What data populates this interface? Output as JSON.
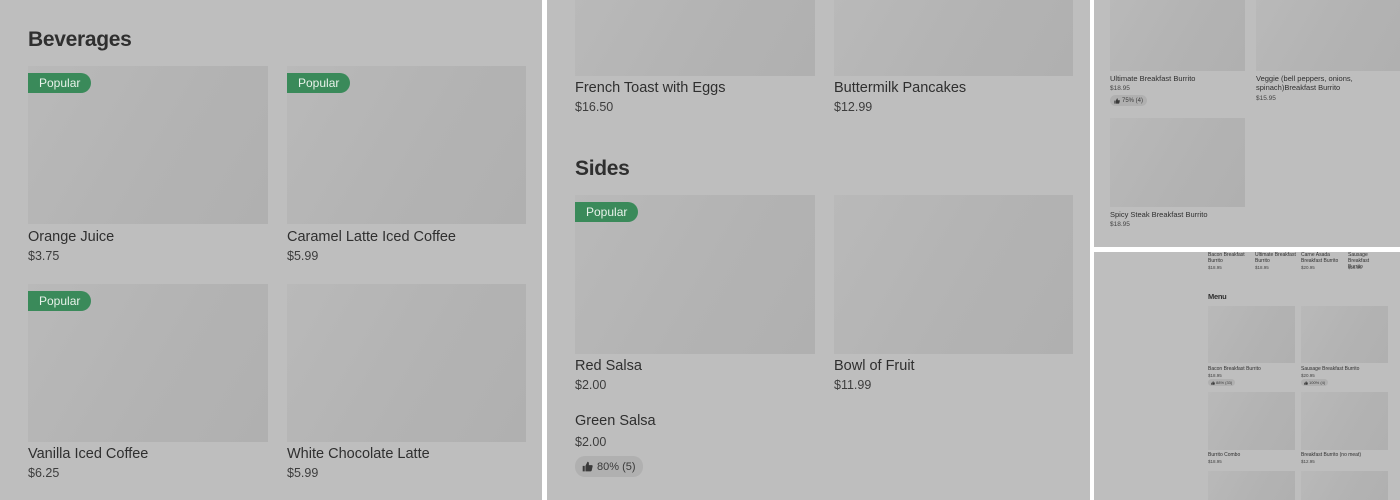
{
  "beverages": {
    "title": "Beverages",
    "items": [
      {
        "name": "Orange Juice",
        "price": "$3.75",
        "badge": "Popular"
      },
      {
        "name": "Caramel Latte Iced Coffee",
        "price": "$5.99",
        "badge": "Popular"
      },
      {
        "name": "Vanilla Iced Coffee",
        "price": "$6.25",
        "badge": "Popular"
      },
      {
        "name": "White Chocolate Latte",
        "price": "$5.99",
        "badge": ""
      }
    ]
  },
  "breakfast_top": {
    "items": [
      {
        "name": "French Toast with Eggs",
        "price": "$16.50"
      },
      {
        "name": "Buttermilk Pancakes",
        "price": "$12.99"
      }
    ]
  },
  "sides": {
    "title": "Sides",
    "items": [
      {
        "name": "Red Salsa",
        "price": "$2.00",
        "badge": "Popular"
      },
      {
        "name": "Bowl of Fruit",
        "price": "$11.99"
      },
      {
        "name": "Green Salsa",
        "price": "$2.00",
        "rating": "80% (5)"
      }
    ]
  },
  "burritos": {
    "items": [
      {
        "name": "Ultimate Breakfast Burrito",
        "price": "$18.95",
        "rating": "75% (4)"
      },
      {
        "name": "Veggie (bell peppers, onions, spinach)Breakfast Burrito",
        "price": "$15.95"
      },
      {
        "name": "Spicy Steak Breakfast Burrito",
        "price": "$18.95"
      }
    ]
  },
  "mini_menu": {
    "top_row": [
      {
        "name": "Bacon Breakfast Burrito",
        "price": "$18.95"
      },
      {
        "name": "Ultimate Breakfast Burrito",
        "price": "$18.95"
      },
      {
        "name": "Carne Asada Breakfast Burrito",
        "price": "$20.95"
      },
      {
        "name": "Sausage Breakfast Burrito",
        "price": "$15.95"
      }
    ],
    "title": "Menu",
    "items": [
      {
        "name": "Bacon Breakfast Burrito",
        "price": "$18.95",
        "rating": "88% (33)"
      },
      {
        "name": "Sausage Breakfast Burrito",
        "price": "$20.95",
        "rating": "100% (4)"
      },
      {
        "name": "Burrito Combo",
        "price": "$18.95"
      },
      {
        "name": "Breakfast Burrito (no meat)",
        "price": "$12.95"
      }
    ]
  },
  "icons": {
    "rating": "thumbs-up-icon"
  },
  "colors": {
    "badge": "#3a8a5a",
    "overlay": "#bebebe"
  }
}
